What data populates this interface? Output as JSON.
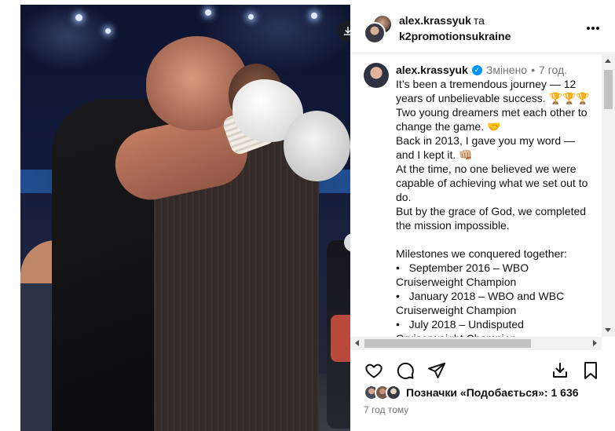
{
  "header": {
    "author": "alex.krassyuk",
    "conjunction": "та",
    "coauthor": "k2promotionsukraine"
  },
  "caption": {
    "username": "alex.krassyuk",
    "edited": "Змінено",
    "separator": "•",
    "time": "7 год.",
    "lines": [
      "It’s been a tremendous journey — 12",
      "years of unbelievable success. 🏆🏆🏆",
      "Two young dreamers met each other to",
      "change the game. 🤝",
      "Back in 2013, I gave you my word —",
      "and I kept it. 👊🏼",
      "At the time, no one believed we were",
      "capable of achieving what we set out to",
      "do.",
      "But by the grace of God, we completed",
      "the mission impossible.",
      "",
      "Milestones we conquered together:",
      "•   September 2016 – WBO",
      "Cruiserweight Champion",
      "•   January 2018 – WBO and WBC",
      "Cruiserweight Champion",
      "•   July 2018 – Undisputed",
      "Cruiserweight Champion"
    ]
  },
  "likes": {
    "text": "Позначки «Подобається»: 1 636"
  },
  "posted": "7 год тому",
  "icons": {
    "download": "download-icon",
    "next": "chevron-right-icon",
    "more": "more-horizontal-icon",
    "like": "heart-icon",
    "comment": "comment-icon",
    "share": "send-icon",
    "save_to_collection": "save-download-icon",
    "bookmark": "bookmark-icon",
    "verified": "verified-badge-icon"
  },
  "colors": {
    "verified": "#0095f6",
    "muted_text": "#737373",
    "primary_text": "#111111"
  }
}
